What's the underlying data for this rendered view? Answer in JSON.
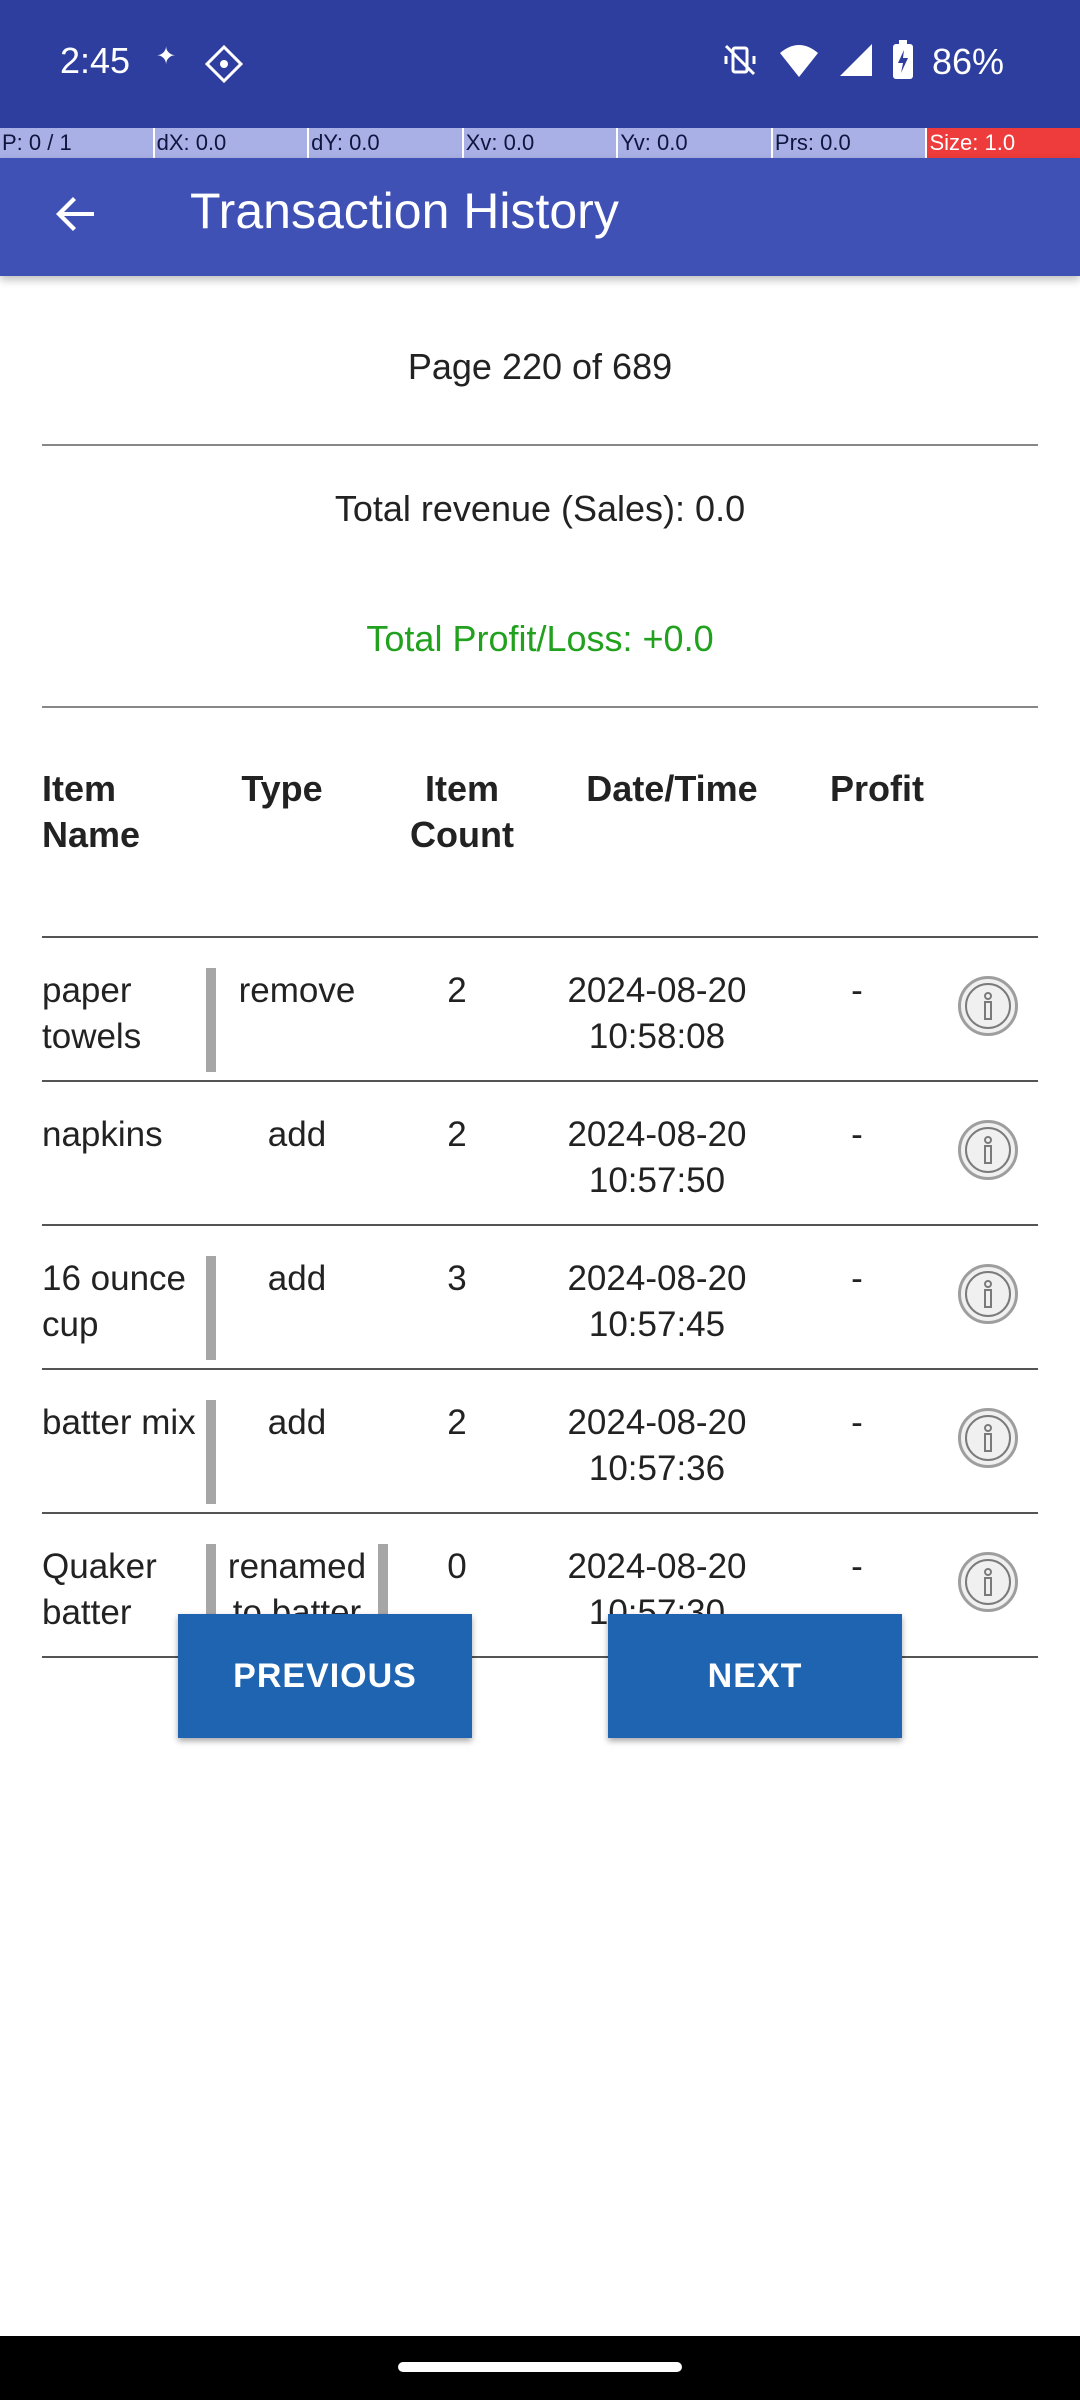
{
  "status_bar": {
    "time": "2:45",
    "battery_percent": "86%",
    "icons": [
      "sparkle-icon",
      "app-notification-icon",
      "mute-vibrate-icon",
      "wifi-icon",
      "signal-icon",
      "battery-charging-icon"
    ]
  },
  "pointer_location": {
    "p": "P: 0 / 1",
    "dx": "dX: 0.0",
    "dy": "dY: 0.0",
    "xv": "Xv: 0.0",
    "yv": "Yv: 0.0",
    "prs": "Prs: 0.0",
    "size": "Size: 1.0"
  },
  "app_bar": {
    "title": "Transaction History",
    "back_icon": "arrow-back-icon"
  },
  "summary": {
    "page_indicator": "Page 220 of 689",
    "total_revenue": "Total revenue (Sales): 0.0",
    "total_profit": "Total Profit/Loss: +0.0"
  },
  "table": {
    "headers": {
      "item_name": "Item Name",
      "type": "Type",
      "item_count": "Item Count",
      "date_time": "Date/Time",
      "profit": "Profit"
    },
    "rows": [
      {
        "name": "paper towels",
        "type": "remove",
        "count": "2",
        "datetime": "2024-08-20 10:58:08",
        "profit": "-"
      },
      {
        "name": "napkins",
        "type": "add",
        "count": "2",
        "datetime": "2024-08-20 10:57:50",
        "profit": "-"
      },
      {
        "name": "16 ounce cup",
        "type": "add",
        "count": "3",
        "datetime": "2024-08-20 10:57:45",
        "profit": "-"
      },
      {
        "name": "batter mix",
        "type": "add",
        "count": "2",
        "datetime": "2024-08-20 10:57:36",
        "profit": "-"
      },
      {
        "name": "Quaker batter",
        "type": "renamed to batter",
        "count": "0",
        "datetime": "2024-08-20 10:57:30",
        "profit": "-"
      }
    ]
  },
  "buttons": {
    "previous": "PREVIOUS",
    "next": "NEXT"
  },
  "colors": {
    "status_bar": "#2e3e9e",
    "app_bar": "#3f51b5",
    "profit_text": "#22a11f",
    "button": "#1e64b0",
    "size_alert": "#ee3b3b"
  }
}
